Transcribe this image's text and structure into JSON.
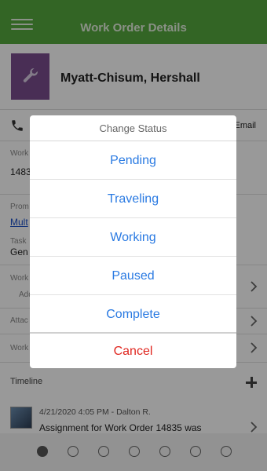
{
  "header": {
    "title": "Work Order Details"
  },
  "profile": {
    "name": "Myatt-Chisum, Hershall"
  },
  "contact": {
    "email_label": "Email"
  },
  "fields": {
    "work_label": "Work",
    "work_value": "1483",
    "prom_label": "Prom",
    "prom_value": "Mult",
    "task_label": "Task",
    "task_value": "Gen",
    "work2_label": "Work",
    "work2_sub": "Add",
    "attach_label": "Attac",
    "work3_label": "Work"
  },
  "timeline": {
    "label": "Timeline",
    "entry_meta": "4/21/2020 4:05 PM  - Dalton R.",
    "entry_text": "Assignment for Work Order 14835 was"
  },
  "pager": {
    "count": 7,
    "active_index": 0
  },
  "dialog": {
    "title": "Change Status",
    "options": [
      "Pending",
      "Traveling",
      "Working",
      "Paused",
      "Complete"
    ],
    "cancel": "Cancel"
  },
  "colors": {
    "header_green": "#55a83e",
    "avatar_purple": "#7b4d8e",
    "option_blue": "#2a7ae2",
    "cancel_red": "#e0261f"
  },
  "icons": {
    "menu": "hamburger-menu-icon",
    "wrench": "wrench-icon",
    "phone": "phone-icon",
    "chevron": "chevron-right-icon",
    "plus": "plus-icon"
  }
}
